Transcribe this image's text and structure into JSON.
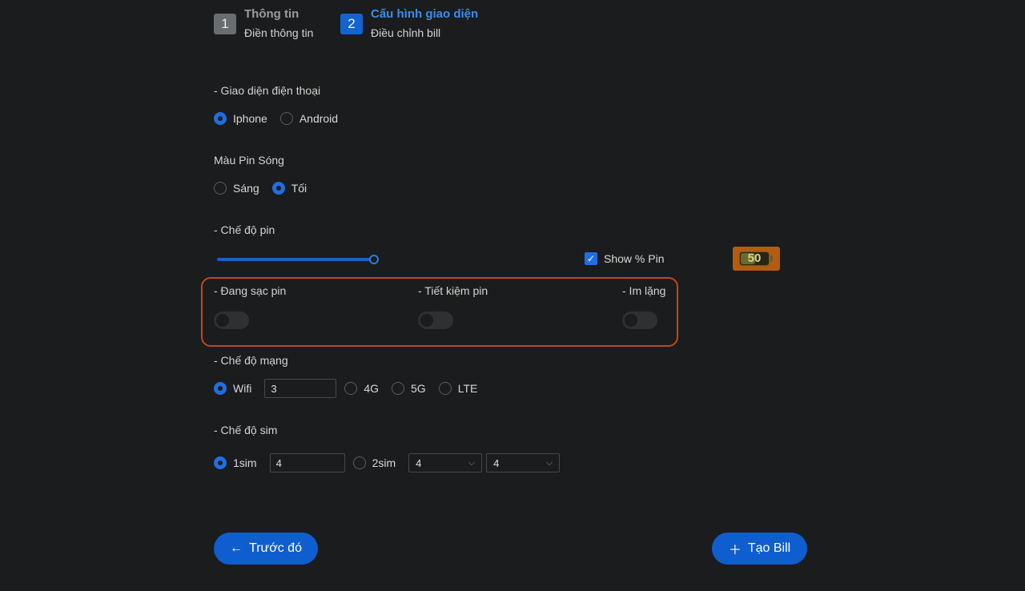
{
  "steps": [
    {
      "number": "1",
      "title": "Thông tin",
      "subtitle": "Điền thông tin"
    },
    {
      "number": "2",
      "title": "Cấu hình giao diện",
      "subtitle": "Điều chỉnh bill"
    }
  ],
  "phone_ui": {
    "label": "- Giao diện điện thoại",
    "options": [
      "Iphone",
      "Android"
    ],
    "selected": "Iphone"
  },
  "battery_color": {
    "label": "Màu Pin Sóng",
    "options": [
      "Sáng",
      "Tối"
    ],
    "selected": "Tối"
  },
  "battery_mode": {
    "label": "- Chế độ pin",
    "slider_value": 100,
    "show_percent_label": "Show % Pin",
    "show_percent_checked": true,
    "preview_value": "50",
    "preview_bg_color": "#b35c0f"
  },
  "toggles": [
    {
      "label": "- Đang sạc pin",
      "on": false
    },
    {
      "label": "- Tiết kiệm pin",
      "on": false
    },
    {
      "label": "- Im lặng",
      "on": false
    }
  ],
  "network": {
    "label": "- Chế độ mạng",
    "options": [
      "Wifi",
      "4G",
      "5G",
      "LTE"
    ],
    "selected": "Wifi",
    "wifi_value": "3"
  },
  "sim": {
    "label": "- Chế độ sim",
    "options": [
      "1sim",
      "2sim"
    ],
    "selected": "1sim",
    "sim1_value": "4",
    "sim2_select_1": "4",
    "sim2_select_2": "4"
  },
  "buttons": {
    "prev_label": "Trước đó",
    "create_label": "Tạo Bill"
  },
  "colors": {
    "accent": "#1f6fe0",
    "highlight_border": "#c4471a",
    "background": "#1b1c1d"
  },
  "icons": {
    "prev": "arrow-left-icon",
    "create": "plus-icon"
  }
}
